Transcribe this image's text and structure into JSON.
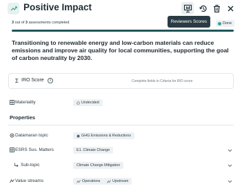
{
  "header": {
    "title": "Positive Impact",
    "tooltip": "Reviewers Scores"
  },
  "progress": {
    "completed": "3",
    "total": "3",
    "out_of_text": "out of",
    "suffix_text": "assessments completed",
    "status": "Done",
    "fraction": 1.0
  },
  "statement": "Transitioning to renewable energy and low-carbon materials can reduce emissions and improve air quality for local communities, supporting the goal of carbon neutrality by 2030.",
  "iro": {
    "sigma": "Σ",
    "title": "IRO Score",
    "info": "i",
    "hint": "Complete fields in Criteria for IRO score"
  },
  "materiality": {
    "label": "Materiality",
    "value": "Undecided"
  },
  "properties": {
    "title": "Properties",
    "rows": [
      {
        "label": "Datamaran topic",
        "value": "GHG Emissions & Reductions"
      },
      {
        "label": "ESRS Sus. Matters",
        "value": "E1. Climate Change"
      },
      {
        "label": "Sub-topic",
        "value": "Climate Change Mitigation"
      },
      {
        "label": "Value streams",
        "values": [
          "Operations",
          "Upstream"
        ]
      }
    ]
  },
  "colors": {
    "accent": "#1e5559",
    "done_dot": "#3e9f93",
    "tooltip_bg": "#2a3b44",
    "pill_bg": "#eef1f3"
  },
  "icons": {
    "impact": "trend-up-icon",
    "reviewers": "presentation-icon",
    "history": "history-icon",
    "delete": "trash-icon",
    "close": "close-icon"
  }
}
